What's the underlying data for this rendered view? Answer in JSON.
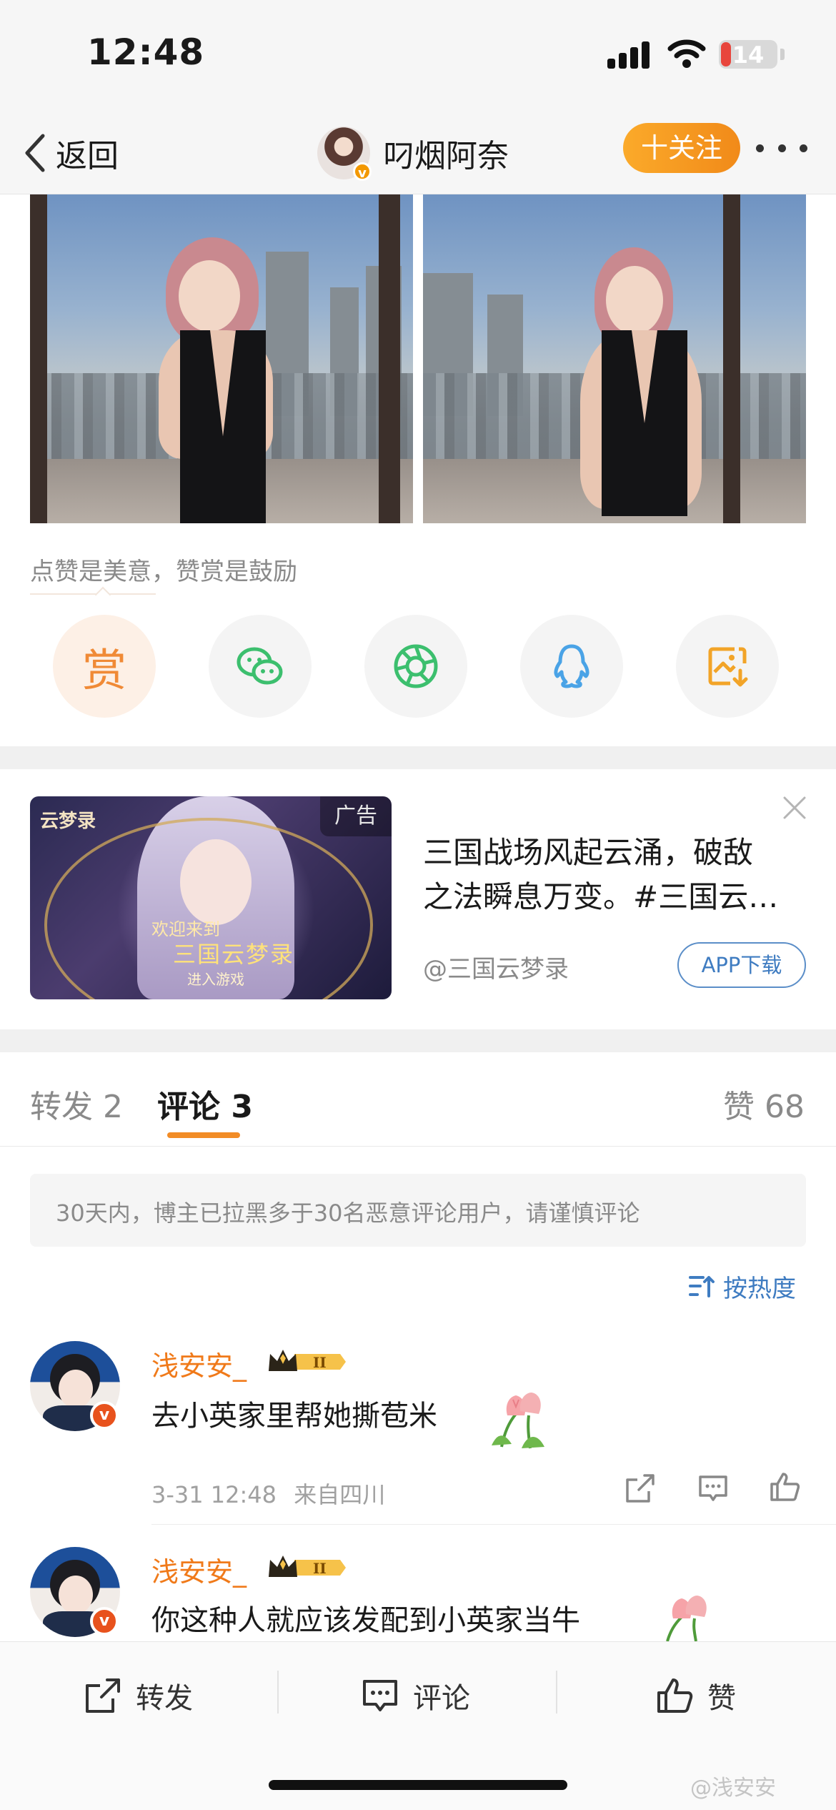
{
  "status_bar": {
    "time": "12:48",
    "battery": "14"
  },
  "nav": {
    "back_label": "返回",
    "username": "叼烟阿奈",
    "follow_label": "十关注"
  },
  "post": {
    "reward_hint": "点赞是美意，赞赏是鼓励",
    "reward_label": "赏",
    "share_targets": [
      "reward",
      "wechat",
      "moments",
      "qq",
      "save-image"
    ]
  },
  "ad": {
    "badge": "广告",
    "logo": "云梦录",
    "welcome": "欢迎来到",
    "game_title": "三国云梦录",
    "enter": "进入游戏",
    "text_line1": "三国战场风起云涌，破敌",
    "text_line2": "之法瞬息万变。#三国云…",
    "source": "@三国云梦录",
    "download_label": "APP下载"
  },
  "tabs": {
    "repost": "转发 2",
    "comment": "评论 3",
    "like": "赞 68"
  },
  "notice": "30天内，博主已拉黑多于30名恶意评论用户，请谨慎评论",
  "sort_label": "按热度",
  "comments": [
    {
      "name": "浅安安_",
      "text": "去小英家里帮她撕苞米",
      "time": "3-31 12:48",
      "location": "来自四川"
    },
    {
      "name": "浅安安_",
      "text": "你这种人就应该发配到小英家当牛"
    }
  ],
  "bottom_bar": {
    "repost": "转发",
    "comment": "评论",
    "like": "赞"
  },
  "watermark": "@浅安安",
  "colors": {
    "accent_orange": "#f28c26",
    "link_blue": "#3f7cc1",
    "name_orange": "#f07a1a"
  }
}
